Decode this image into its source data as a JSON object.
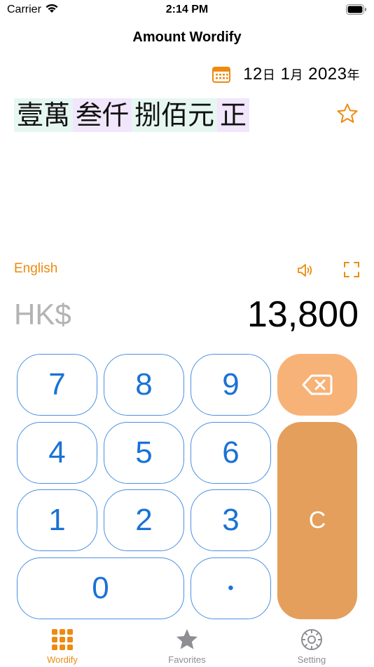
{
  "status_bar": {
    "carrier": "Carrier",
    "time": "2:14 PM"
  },
  "nav": {
    "title": "Amount Wordify"
  },
  "date": {
    "day": "12",
    "day_unit": "日",
    "month": "1",
    "month_unit": "月",
    "year": "2023",
    "year_unit": "年"
  },
  "words": [
    {
      "text": "壹萬",
      "style": "a"
    },
    {
      "text": "叁仟",
      "style": "b"
    },
    {
      "text": "捌佰元",
      "style": "a"
    },
    {
      "text": "正",
      "style": "b"
    }
  ],
  "controls": {
    "language": "English"
  },
  "display": {
    "currency": "HK$",
    "amount": "13,800"
  },
  "keypad": {
    "k7": "7",
    "k8": "8",
    "k9": "9",
    "k4": "4",
    "k5": "5",
    "k6": "6",
    "k1": "1",
    "k2": "2",
    "k3": "3",
    "k0": "0",
    "kdot": "•",
    "clear": "C"
  },
  "tabs": [
    {
      "label": "Wordify",
      "icon": "grid-icon",
      "active": true
    },
    {
      "label": "Favorites",
      "icon": "star-icon",
      "active": false
    },
    {
      "label": "Setting",
      "icon": "gear-icon",
      "active": false
    }
  ],
  "colors": {
    "accent": "#ee8a10",
    "key_blue": "#1a72d6",
    "backspace_bg": "#f7b277",
    "clear_bg": "#e49f5c"
  }
}
